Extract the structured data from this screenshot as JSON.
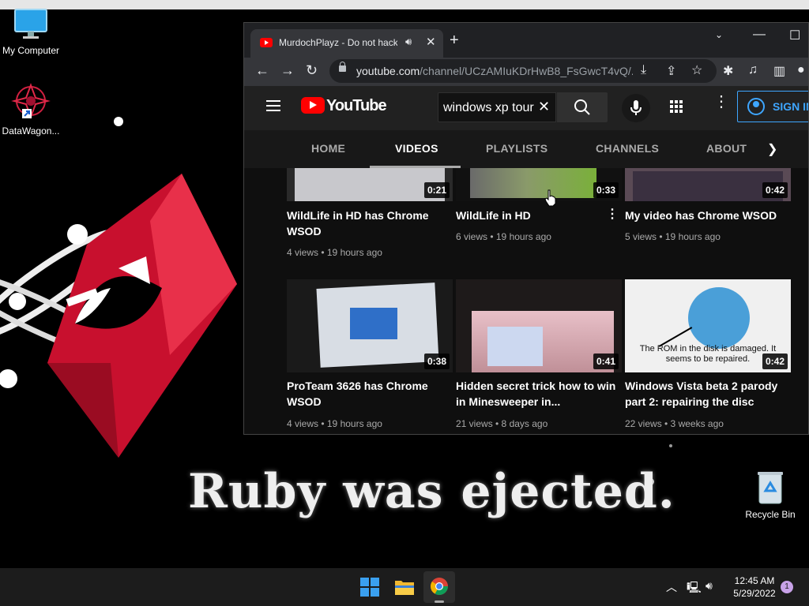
{
  "desktop": {
    "icons": [
      {
        "label": "My Computer"
      },
      {
        "label": "DataWagon..."
      },
      {
        "label": "Recycle Bin"
      }
    ],
    "wallpaper_caption": "Ruby was ejected."
  },
  "browser": {
    "tab": {
      "title": "MurdochPlayz - Do not hack",
      "audio_icon": "speaker-icon",
      "close_icon": "close-icon"
    },
    "new_tab_label": "+",
    "url": {
      "host": "youtube.com",
      "path": "/channel/UCzAMIuKDrHwB8_FsGwcT4vQ/..."
    }
  },
  "youtube": {
    "logo_text": "YouTube",
    "search": {
      "query": "windows xp tour"
    },
    "signin_label": "SIGN IN",
    "tabs": [
      {
        "label": "HOME"
      },
      {
        "label": "VIDEOS"
      },
      {
        "label": "PLAYLISTS"
      },
      {
        "label": "CHANNELS"
      },
      {
        "label": "ABOUT"
      }
    ],
    "active_tab": "VIDEOS",
    "videos": [
      {
        "title": "WildLife in HD has Chrome WSOD",
        "duration": "0:21",
        "meta": "4 views • 19 hours ago"
      },
      {
        "title": "WildLife in HD",
        "duration": "0:33",
        "meta": "6 views • 19 hours ago"
      },
      {
        "title": "My video has Chrome WSOD",
        "duration": "0:42",
        "meta": "5 views • 19 hours ago"
      },
      {
        "title": "ProTeam 3626 has Chrome WSOD",
        "duration": "0:38",
        "meta": "4 views • 19 hours ago"
      },
      {
        "title": "Hidden secret trick how to win in Minesweeper in...",
        "duration": "0:41",
        "meta": "21 views • 8 days ago"
      },
      {
        "title": "Windows Vista beta 2 parody part 2: repairing the disc",
        "duration": "0:42",
        "meta": "22 views • 3 weeks ago",
        "thumb_text": "The ROM in the disk is damaged. It seems to be repaired."
      }
    ]
  },
  "taskbar": {
    "time": "12:45 AM",
    "date": "5/29/2022",
    "notification_count": "1"
  }
}
